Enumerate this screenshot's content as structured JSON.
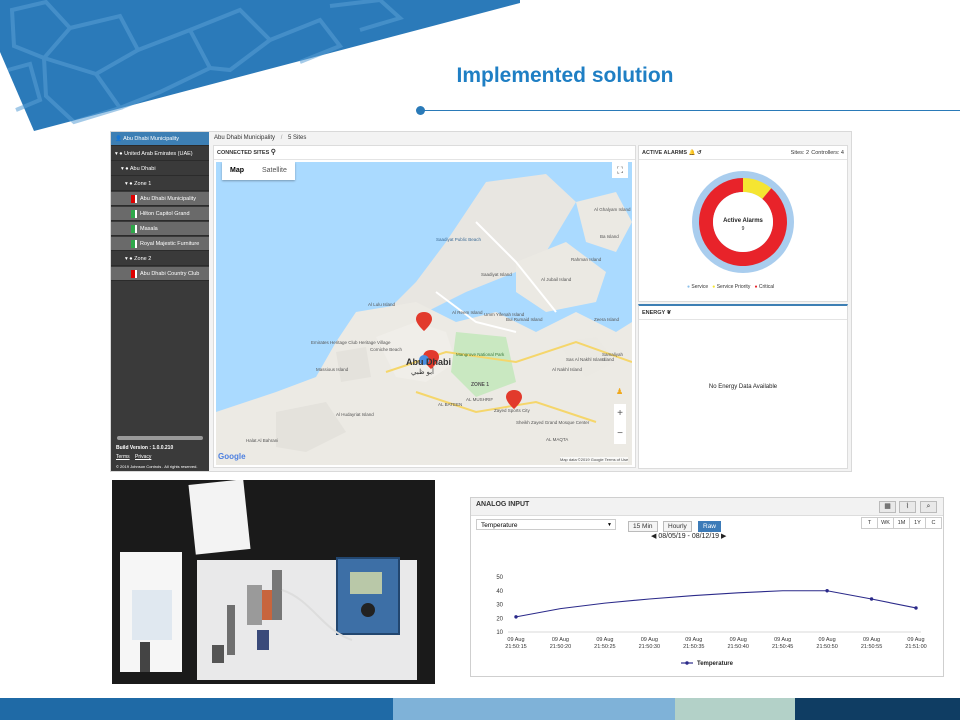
{
  "slide": {
    "title": "Implemented solution"
  },
  "dashboard": {
    "sidebar": {
      "items": [
        {
          "label": "Abu Dhabi Municipality",
          "prefix": "👤"
        },
        {
          "label": "United Arab Emirates (UAE)",
          "prefix": "▾ ●"
        },
        {
          "label": "Abu Dhabi",
          "prefix": "▾ ●"
        },
        {
          "label": "Zone 1",
          "prefix": "▾ ●"
        },
        {
          "label": "Abu Dhabi Municipality"
        },
        {
          "label": "Hilton Capitol Grand"
        },
        {
          "label": "Masala"
        },
        {
          "label": "Royal Majestic Furniture"
        },
        {
          "label": "Zone 2",
          "prefix": "▾ ●"
        },
        {
          "label": "Abu Dhabi Country Club"
        }
      ],
      "build_version": "Build Version : 1.0.0.210",
      "terms": "Terms",
      "privacy": "Privacy",
      "copyright": "© 2019 Johnson Controls . All rights reserved."
    },
    "breadcrumb": {
      "org": "Abu Dhabi Municipality",
      "sep": "/",
      "sites": "5 Sites"
    },
    "connected_sites": {
      "heading": "CONNECTED SITES",
      "map_tab": "Map",
      "satellite_tab": "Satellite",
      "google": "Google",
      "attribution": "Map data ©2019 Google   Terms of Use",
      "labels": {
        "saadiyat_beach": "Saadiyat Public Beach",
        "saadiyat_island": "Saadiyat Island",
        "al_lulu": "Al Lulu Island",
        "al_reem": "Al Reem Island",
        "umm_yifenah": "Umm Yifenah Island",
        "al_jubail": "Al Jubail Island",
        "rahman_island": "Rahman Island",
        "bu_ghalyam": "Al Ghalyam Island",
        "ba_island": "Ba Island",
        "zeera": "Zeera Island",
        "samaliyah": "Samaliyah Island",
        "sas_al_nakhl": "Sas Al Nakhl Island",
        "mangrove": "Mangrove National Park",
        "abu_dhabi": "Abu Dhabi",
        "abu_dhabi_ar": "أبو ظبي",
        "zone_1": "ZONE 1",
        "al_hudayriat": "Al Hudayriat Island",
        "massious": "Massious Island",
        "halat": "Halat Al Bahrani",
        "bul_rumaid": "Bul Rumaid Island",
        "heritage": "Emirates Heritage Club Heritage Village",
        "corniche": "Corniche Beach",
        "mosque": "Sheikh Zayed Grand Mosque Center",
        "al_maqta": "AL MAQTA",
        "al_mushrif": "AL MUSHRIF",
        "al_bateen": "AL BATEEN",
        "sas_al_nakhl_2": "Al Nakhl Island",
        "zaman": "Zayed Sports City"
      }
    },
    "active_alarms": {
      "heading": "ACTIVE ALARMS",
      "sites": "Sites: 2",
      "controllers": "Controllers: 4",
      "center_label": "Active Alarms",
      "center_value": "9",
      "legend": [
        "Service",
        "Service Priority",
        "Critical"
      ],
      "segments": [
        {
          "name": "Service",
          "value": 0,
          "color": "#8cc0ea"
        },
        {
          "name": "Service Priority",
          "value": 1,
          "color": "#f5e531"
        },
        {
          "name": "Critical",
          "value": 8,
          "color": "#e8232a"
        }
      ],
      "ring_values": {
        "outer_critical": 8,
        "outer_priority": 1,
        "inner_count": 9
      }
    },
    "energy": {
      "heading": "ENERGY",
      "message": "No Energy Data Available"
    }
  },
  "analog": {
    "heading": "ANALOG INPUT",
    "select_value": "Temperature",
    "tabs": [
      "15 Min",
      "Hourly",
      "Raw"
    ],
    "active_tab": "Raw",
    "range_buttons": [
      "T",
      "WK",
      "1M",
      "1Y",
      "C"
    ],
    "date_range": "08/05/19 - 08/12/19",
    "legend": "Temperature"
  },
  "chart_data": {
    "type": "line",
    "title": "",
    "xlabel": "",
    "ylabel": "",
    "x": [
      "09 Aug 21:50:15",
      "09 Aug 21:50:20",
      "09 Aug 21:50:25",
      "09 Aug 21:50:30",
      "09 Aug 21:50:35",
      "09 Aug 21:50:40",
      "09 Aug 21:50:45",
      "09 Aug 21:50:50",
      "09 Aug 21:50:55",
      "09 Aug 21:51:00"
    ],
    "series": [
      {
        "name": "Temperature",
        "values": [
          21,
          27,
          31,
          34,
          36.5,
          38.5,
          40,
          40,
          34,
          27.5
        ],
        "color": "#2b2a8a"
      }
    ],
    "marker_indices": [
      0,
      7,
      8,
      9
    ],
    "yticks": [
      10,
      20,
      30,
      40,
      50
    ],
    "ylim": [
      10,
      50
    ],
    "grid": false,
    "legend_position": "bottom"
  },
  "footer": {
    "colors": [
      "#1f6aa6",
      "#7fb2d8",
      "#b3d1c8",
      "#0f3d63"
    ]
  }
}
